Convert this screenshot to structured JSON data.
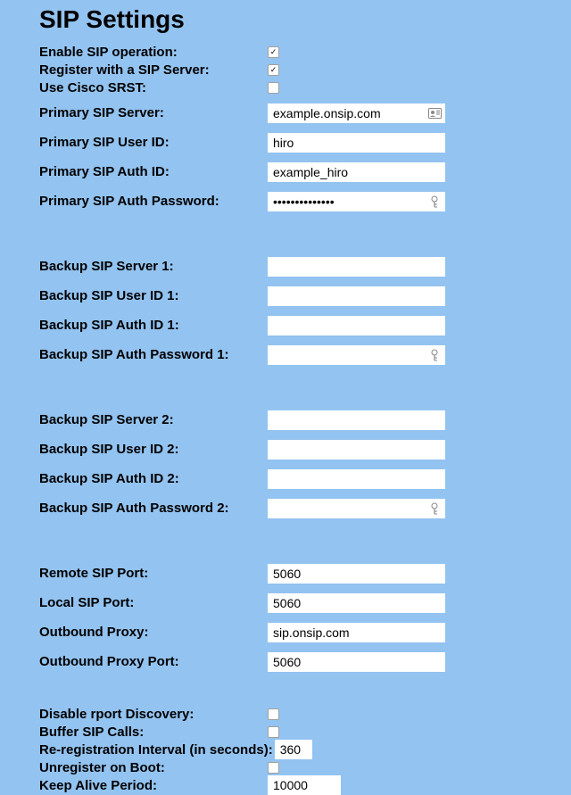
{
  "title": "SIP Settings",
  "top": {
    "enable_label": "Enable SIP operation:",
    "enable_checked": true,
    "register_label": "Register with a SIP Server:",
    "register_checked": true,
    "srst_label": "Use Cisco SRST:",
    "srst_checked": false
  },
  "primary": {
    "server_label": "Primary SIP Server:",
    "server_value": "example.onsip.com",
    "user_label": "Primary SIP User ID:",
    "user_value": "hiro",
    "auth_label": "Primary SIP Auth ID:",
    "auth_value": "example_hiro",
    "pwd_label": "Primary SIP Auth Password:",
    "pwd_value": "••••••••••••••"
  },
  "backup1": {
    "server_label": "Backup SIP Server 1:",
    "server_value": "",
    "user_label": "Backup SIP User ID 1:",
    "user_value": "",
    "auth_label": "Backup SIP Auth ID 1:",
    "auth_value": "",
    "pwd_label": "Backup SIP Auth Password 1:",
    "pwd_value": ""
  },
  "backup2": {
    "server_label": "Backup SIP Server 2:",
    "server_value": "",
    "user_label": "Backup SIP User ID 2:",
    "user_value": "",
    "auth_label": "Backup SIP Auth ID 2:",
    "auth_value": "",
    "pwd_label": "Backup SIP Auth Password 2:",
    "pwd_value": ""
  },
  "ports": {
    "remote_label": "Remote SIP Port:",
    "remote_value": "5060",
    "local_label": "Local SIP Port:",
    "local_value": "5060",
    "proxy_label": "Outbound Proxy:",
    "proxy_value": "sip.onsip.com",
    "proxy_port_label": "Outbound Proxy Port:",
    "proxy_port_value": "5060"
  },
  "bottom": {
    "rport_label": "Disable rport Discovery:",
    "rport_checked": false,
    "buffer_label": "Buffer SIP Calls:",
    "buffer_checked": false,
    "rereg_label": "Re-registration Interval (in seconds):",
    "rereg_value": "360",
    "unreg_label": "Unregister on Boot:",
    "unreg_checked": false,
    "keepalive_label": "Keep Alive Period:",
    "keepalive_value": "10000"
  }
}
